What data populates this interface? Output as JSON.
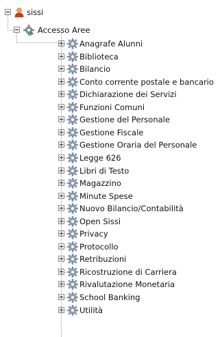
{
  "tree": {
    "root": {
      "label": "sissi",
      "icon": "user-icon",
      "expanded": true
    },
    "group": {
      "label": "Accesso Aree",
      "icon": "gear-icon",
      "expanded": true
    },
    "items": [
      {
        "label": "Anagrafe Alunni"
      },
      {
        "label": "Biblioteca"
      },
      {
        "label": "Bilancio"
      },
      {
        "label": "Conto corrente postale e bancario"
      },
      {
        "label": "Dichiarazione dei Servizi"
      },
      {
        "label": "Funzioni Comuni"
      },
      {
        "label": "Gestione del Personale"
      },
      {
        "label": "Gestione Fiscale"
      },
      {
        "label": "Gestione Oraria del Personale"
      },
      {
        "label": "Legge 626"
      },
      {
        "label": "Libri di Testo"
      },
      {
        "label": "Magazzino"
      },
      {
        "label": "Minute Spese"
      },
      {
        "label": "Nuovo Bilancio/Contabilità"
      },
      {
        "label": "Open Sissi"
      },
      {
        "label": "Privacy"
      },
      {
        "label": "Protocollo"
      },
      {
        "label": "Retribuzioni"
      },
      {
        "label": "Ricostruzione di Carriera"
      },
      {
        "label": "Rivalutazione Monetaria"
      },
      {
        "label": "School Banking"
      },
      {
        "label": "Utilità"
      }
    ],
    "item_icon": "gear-icon",
    "colors": {
      "gear": "#7f93a8",
      "gear_badge": "#3aa53a",
      "user_head": "#f2a25c",
      "user_body": "#d9331f"
    }
  }
}
